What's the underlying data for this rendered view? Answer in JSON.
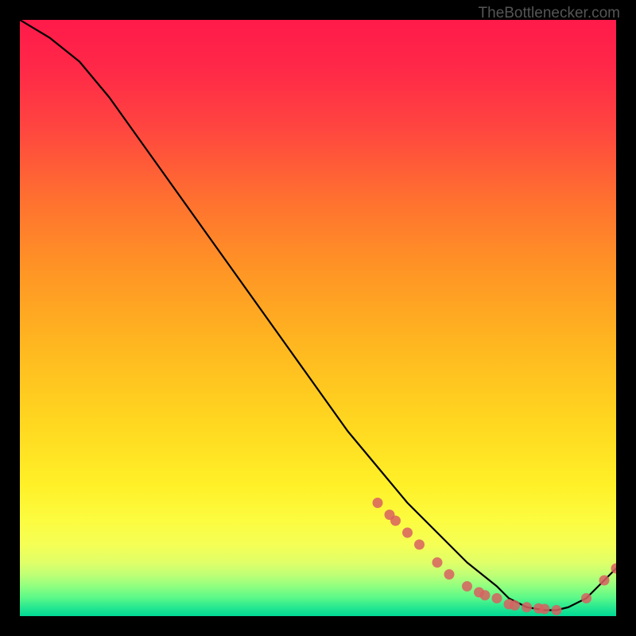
{
  "watermark": "TheBottlenecker.com",
  "chart_data": {
    "type": "line",
    "title": "",
    "xlabel": "",
    "ylabel": "",
    "xlim": [
      0,
      100
    ],
    "ylim": [
      0,
      100
    ],
    "curve": {
      "x": [
        0,
        5,
        10,
        15,
        20,
        25,
        30,
        35,
        40,
        45,
        50,
        55,
        60,
        65,
        70,
        75,
        80,
        82,
        85,
        88,
        90,
        92,
        95,
        100
      ],
      "y": [
        100,
        97,
        93,
        87,
        80,
        73,
        66,
        59,
        52,
        45,
        38,
        31,
        25,
        19,
        14,
        9,
        5,
        3,
        1.5,
        1,
        1,
        1.5,
        3,
        8
      ]
    },
    "markers": {
      "x": [
        60,
        62,
        63,
        65,
        67,
        70,
        72,
        75,
        77,
        78,
        80,
        82,
        83,
        85,
        87,
        88,
        90,
        95,
        98,
        100
      ],
      "y": [
        19,
        17,
        16,
        14,
        12,
        9,
        7,
        5,
        4,
        3.5,
        3,
        2,
        1.8,
        1.5,
        1.3,
        1.2,
        1,
        3,
        6,
        8
      ]
    },
    "gradient_colors": {
      "top": "#ff1744",
      "upper_mid": "#ff6030",
      "mid": "#ffb020",
      "lower_mid": "#ffd020",
      "lower": "#fff030",
      "bottom_band1": "#e8ff60",
      "bottom_band2": "#b0ff70",
      "bottom_band3": "#60ff80",
      "bottom_band4": "#20e890",
      "bottom": "#00d090"
    }
  }
}
